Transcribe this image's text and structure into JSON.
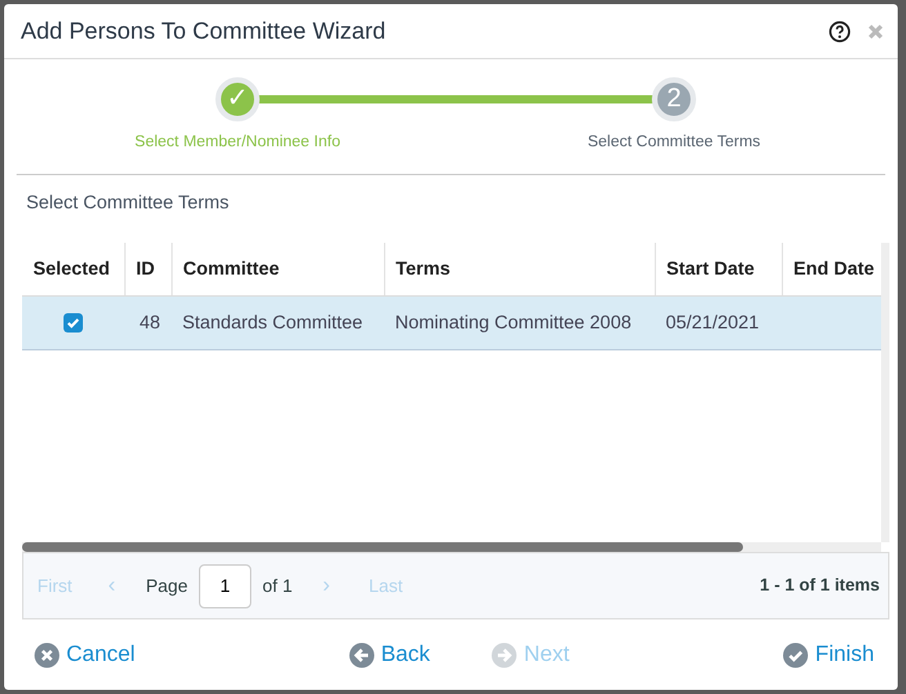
{
  "window": {
    "title": "Add Persons To Committee Wizard"
  },
  "steps": [
    {
      "label": "Select Member/Nominee Info",
      "symbol": "✓",
      "completed": true
    },
    {
      "label": "Select Committee Terms",
      "symbol": "2",
      "completed": false
    }
  ],
  "section_title": "Select Committee Terms",
  "table": {
    "columns": [
      "Selected",
      "ID",
      "Committee",
      "Terms",
      "Start Date",
      "End Date"
    ],
    "rows": [
      {
        "selected": true,
        "id": "48",
        "committee": "Standards Committee",
        "terms": "Nominating Committee 2008",
        "start_date": "05/21/2021",
        "end_date": ""
      }
    ]
  },
  "pager": {
    "first": {
      "label": "First",
      "disabled": true
    },
    "prev": {
      "label": "‹",
      "disabled": true
    },
    "page_label": "Page",
    "page_value": "1",
    "of_label": "of 1",
    "next": {
      "label": "›",
      "disabled": true
    },
    "last": {
      "label": "Last",
      "disabled": true
    },
    "summary": "1 - 1 of 1 items"
  },
  "buttons": [
    {
      "label": "Cancel",
      "kind": "cancel",
      "disabled": false
    },
    {
      "label": "Back",
      "kind": "back",
      "disabled": false
    },
    {
      "label": "Next",
      "kind": "next",
      "disabled": true
    },
    {
      "label": "Finish",
      "kind": "finish",
      "disabled": false
    }
  ]
}
